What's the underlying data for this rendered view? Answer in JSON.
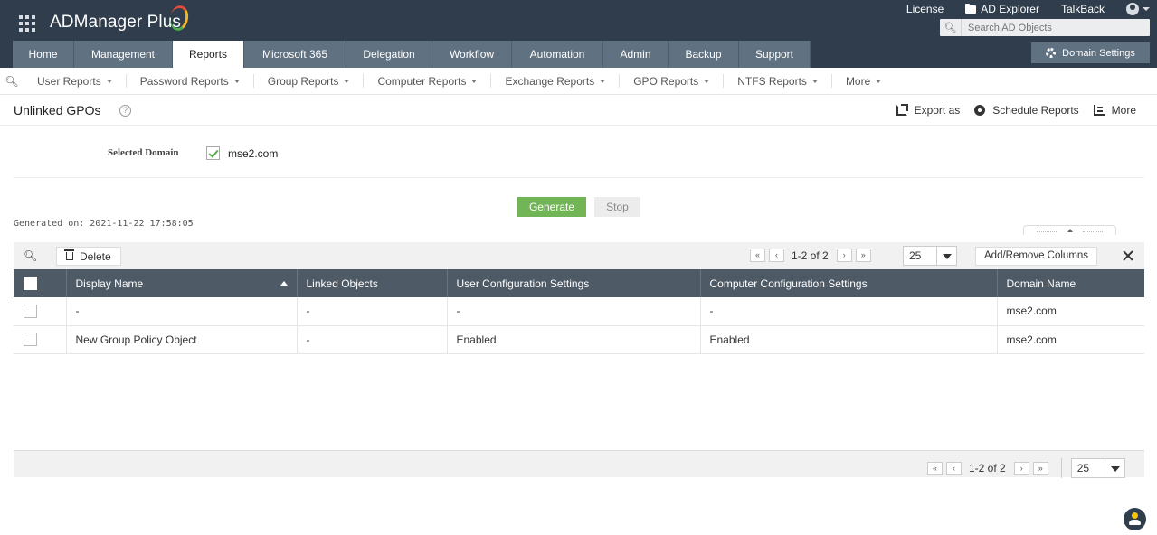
{
  "app": {
    "name": "ADManager Plus"
  },
  "toplinks": {
    "license": "License",
    "ad_explorer": "AD Explorer",
    "talkback": "TalkBack"
  },
  "search": {
    "placeholder": "Search AD Objects"
  },
  "tabs": [
    {
      "label": "Home"
    },
    {
      "label": "Management"
    },
    {
      "label": "Reports"
    },
    {
      "label": "Microsoft 365"
    },
    {
      "label": "Delegation"
    },
    {
      "label": "Workflow"
    },
    {
      "label": "Automation"
    },
    {
      "label": "Admin"
    },
    {
      "label": "Backup"
    },
    {
      "label": "Support"
    }
  ],
  "active_tab": "Reports",
  "domain_settings": "Domain Settings",
  "subnav": [
    {
      "label": "User Reports"
    },
    {
      "label": "Password Reports"
    },
    {
      "label": "Group Reports"
    },
    {
      "label": "Computer Reports"
    },
    {
      "label": "Exchange Reports"
    },
    {
      "label": "GPO Reports"
    },
    {
      "label": "NTFS Reports"
    },
    {
      "label": "More"
    }
  ],
  "page": {
    "title": "Unlinked GPOs",
    "help": "?",
    "actions": {
      "export": "Export as",
      "schedule": "Schedule Reports",
      "more": "More"
    }
  },
  "domain": {
    "label": "Selected Domain",
    "value": "mse2.com",
    "checked": true
  },
  "buttons": {
    "generate": "Generate",
    "stop": "Stop"
  },
  "generated_on": "Generated on: 2021-11-22 17:58:05",
  "toolbar": {
    "delete": "Delete",
    "add_remove": "Add/Remove Columns"
  },
  "pagination": {
    "text": "1-2 of 2",
    "per_page": "25"
  },
  "table": {
    "columns": [
      "Display Name",
      "Linked Objects",
      "User Configuration Settings",
      "Computer Configuration Settings",
      "Domain Name"
    ],
    "rows": [
      [
        "-",
        "-",
        "-",
        "-",
        "mse2.com"
      ],
      [
        "New Group Policy Object",
        "-",
        "Enabled",
        "Enabled",
        "mse2.com"
      ]
    ]
  },
  "colors": {
    "header_bg": "#2f3d4c",
    "tab_bg": "#607181",
    "generate_bg": "#72b556",
    "table_head_bg": "#4e5a66"
  }
}
